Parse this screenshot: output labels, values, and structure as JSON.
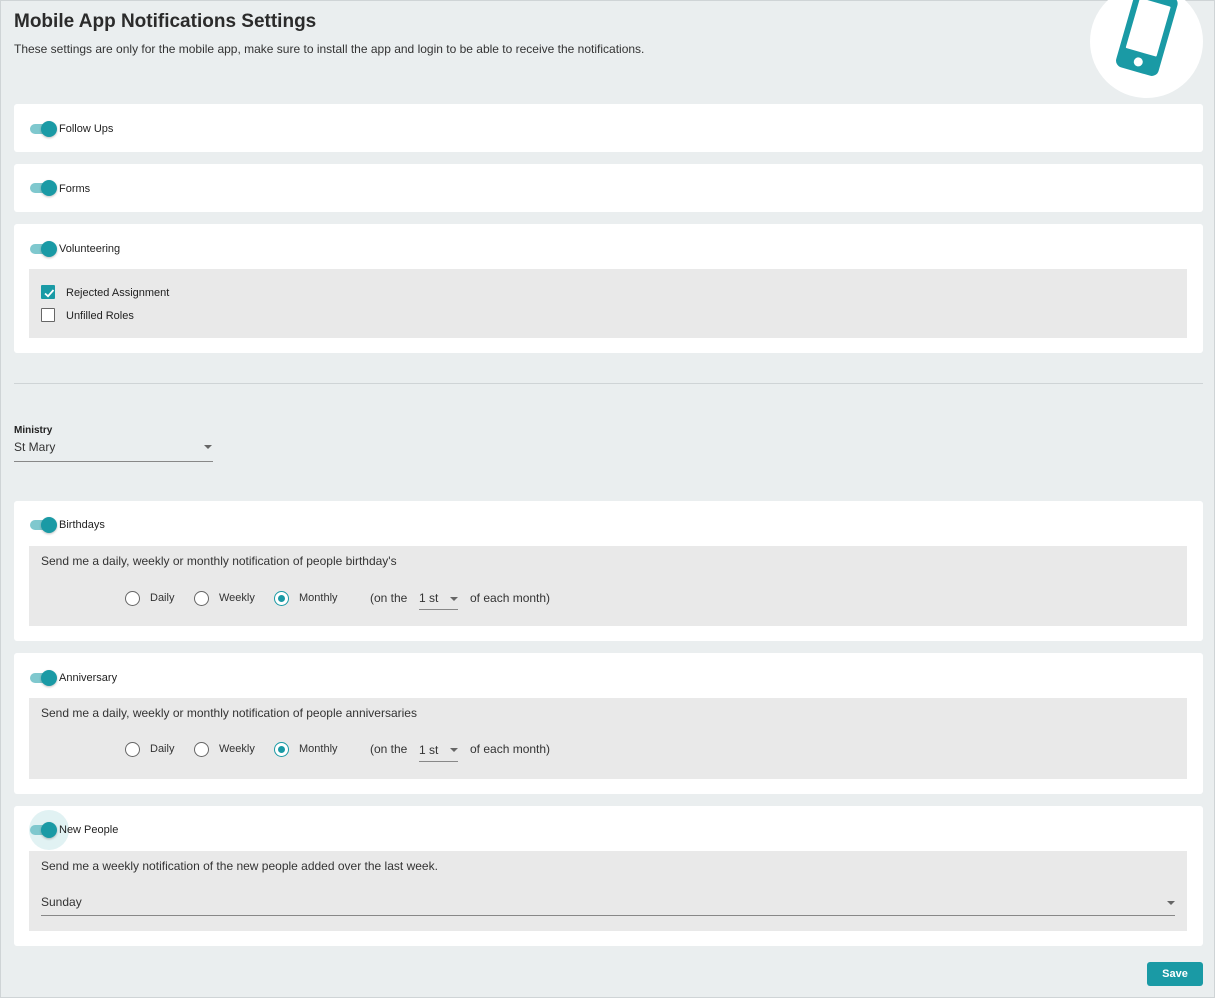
{
  "header": {
    "title": "Mobile App Notifications Settings",
    "subtitle": "These settings are only for the mobile app, make sure to install the app and login to be able to receive the notifications."
  },
  "accent_color": "#1a9aa5",
  "sections": {
    "follow_ups": {
      "label": "Follow Ups",
      "enabled": true
    },
    "forms": {
      "label": "Forms",
      "enabled": true
    },
    "volunteering": {
      "label": "Volunteering",
      "enabled": true,
      "options": [
        {
          "label": "Rejected Assignment",
          "checked": true
        },
        {
          "label": "Unfilled Roles",
          "checked": false
        }
      ]
    }
  },
  "ministry": {
    "label": "Ministry",
    "value": "St Mary"
  },
  "birthdays": {
    "label": "Birthdays",
    "enabled": true,
    "description": "Send me a daily, weekly or monthly notification of people birthday's",
    "frequency": {
      "daily": "Daily",
      "weekly": "Weekly",
      "monthly": "Monthly",
      "selected": "Monthly"
    },
    "on_the": "(on the",
    "day": "1 st",
    "of_each_month": "of each month)"
  },
  "anniversary": {
    "label": "Anniversary",
    "enabled": true,
    "description": "Send me a daily, weekly or monthly notification of people anniversaries",
    "frequency": {
      "daily": "Daily",
      "weekly": "Weekly",
      "monthly": "Monthly",
      "selected": "Monthly"
    },
    "on_the": "(on the",
    "day": "1 st",
    "of_each_month": "of each month)"
  },
  "new_people": {
    "label": "New People",
    "enabled": true,
    "description": "Send me a weekly notification of the new people added over the last week.",
    "weekday": "Sunday"
  },
  "actions": {
    "save_label": "Save"
  }
}
